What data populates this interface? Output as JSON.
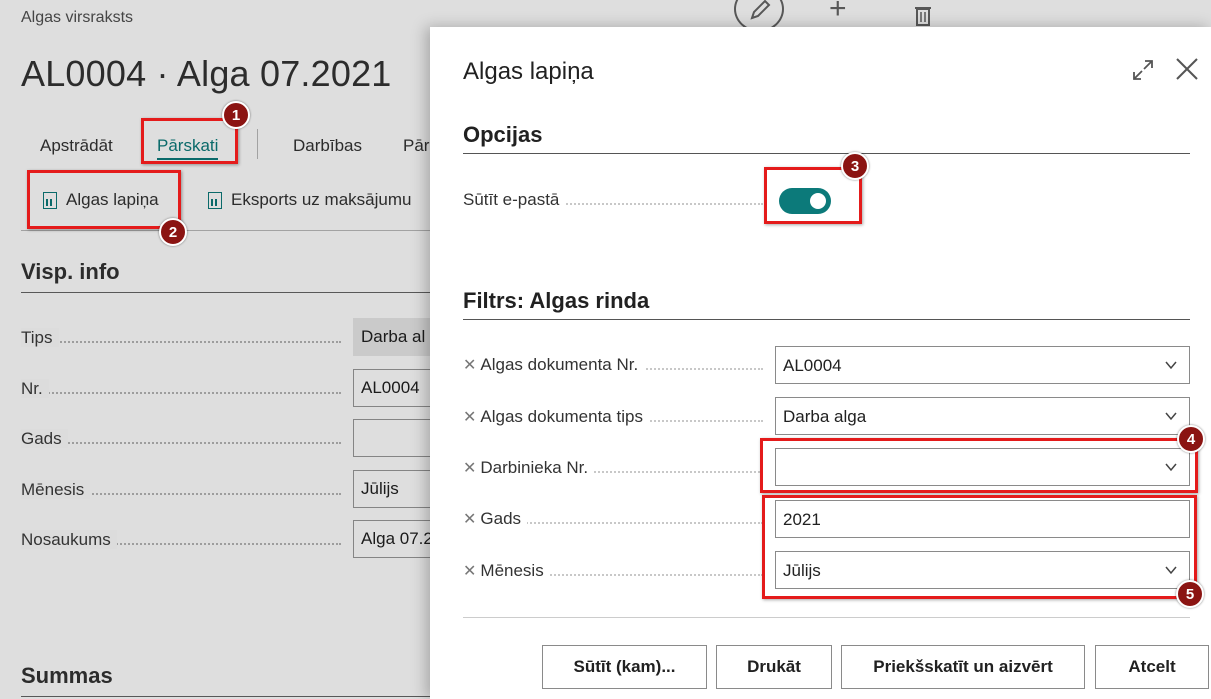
{
  "background": {
    "caption": "Algas virsraksts",
    "title": "AL0004 · Alga 07.2021",
    "tabs": [
      "Apstrādāt",
      "Pārskati",
      "Darbības",
      "Pār"
    ],
    "actions": [
      "Algas lapiņa",
      "Eksports uz maksājumu"
    ],
    "section_general": "Visp. info",
    "section_totals": "Summas",
    "fields": [
      {
        "label": "Tips",
        "value": "Darba al"
      },
      {
        "label": "Nr.",
        "value": "AL0004"
      },
      {
        "label": "Gads",
        "value": ""
      },
      {
        "label": "Mēnesis",
        "value": "Jūlijs"
      },
      {
        "label": "Nosaukums",
        "value": "Alga 07.2"
      }
    ]
  },
  "dialog": {
    "title": "Algas lapiņa",
    "options_section": "Opcijas",
    "send_email_label": "Sūtīt e-pastā",
    "send_email_on": true,
    "filter_section": "Filtrs: Algas rinda",
    "filters": [
      {
        "label": "Algas dokumenta Nr.",
        "value": "AL0004",
        "dropdown": true
      },
      {
        "label": "Algas dokumenta tips",
        "value": "Darba alga",
        "dropdown": true
      },
      {
        "label": "Darbinieka Nr.",
        "value": "",
        "dropdown": true
      },
      {
        "label": "Gads",
        "value": "2021",
        "dropdown": false
      },
      {
        "label": "Mēnesis",
        "value": "Jūlijs",
        "dropdown": true
      }
    ],
    "buttons": {
      "send_to": "Sūtīt (kam)...",
      "print": "Drukāt",
      "preview_close": "Priekšskatīt un aizvērt",
      "cancel": "Atcelt"
    }
  },
  "callouts": [
    "1",
    "2",
    "3",
    "4",
    "5"
  ],
  "colors": {
    "accent": "#0c7a7a",
    "highlight": "#e41b1b",
    "badge": "#8b1412"
  }
}
